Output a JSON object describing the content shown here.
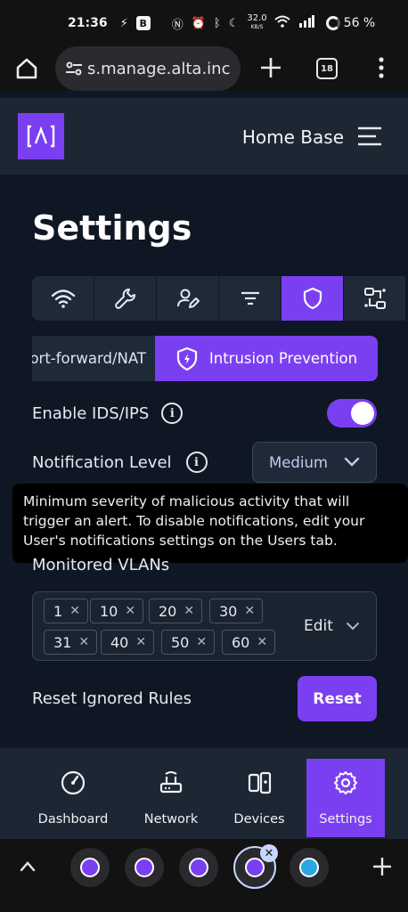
{
  "status_bar": {
    "time": "21:36",
    "badge": "B",
    "net_speed": "32.0",
    "net_unit": "KB/S",
    "battery": "56 %"
  },
  "browser": {
    "url": "s.manage.alta.inc",
    "tab_count": "18"
  },
  "header": {
    "logo_text": "[Λ]",
    "title": "Home Base"
  },
  "page": {
    "title": "Settings"
  },
  "tabs": [
    {
      "icon": "wifi-icon"
    },
    {
      "icon": "wrench-icon"
    },
    {
      "icon": "user-edit-icon"
    },
    {
      "icon": "filter-icon"
    },
    {
      "icon": "shield-icon",
      "active": true
    },
    {
      "icon": "network-icon"
    }
  ],
  "subtabs": {
    "port_forward": "Port-forward/NAT",
    "intrusion_prevention": "Intrusion Prevention"
  },
  "ids": {
    "enable_label": "Enable IDS/IPS",
    "enabled": true,
    "notification_label": "Notification Level",
    "notification_value": "Medium",
    "tooltip": "Minimum severity of malicious activity that will trigger an alert. To disable notifications, edit your User's notifications settings on the Users tab.",
    "vlans_label": "Monitored VLANs",
    "vlans": [
      "1",
      "10",
      "20",
      "30",
      "31",
      "40",
      "50",
      "60"
    ],
    "vlans_edit": "Edit",
    "reset_label": "Reset Ignored Rules",
    "reset_button": "Reset"
  },
  "bottom_nav": [
    {
      "label": "Dashboard",
      "icon": "gauge-icon"
    },
    {
      "label": "Network",
      "icon": "router-icon"
    },
    {
      "label": "Devices",
      "icon": "devices-icon"
    },
    {
      "label": "Settings",
      "icon": "gear-icon",
      "active": true
    }
  ],
  "colors": {
    "accent": "#7b3ff2",
    "background": "#0f1724",
    "panel": "#1d2633"
  }
}
